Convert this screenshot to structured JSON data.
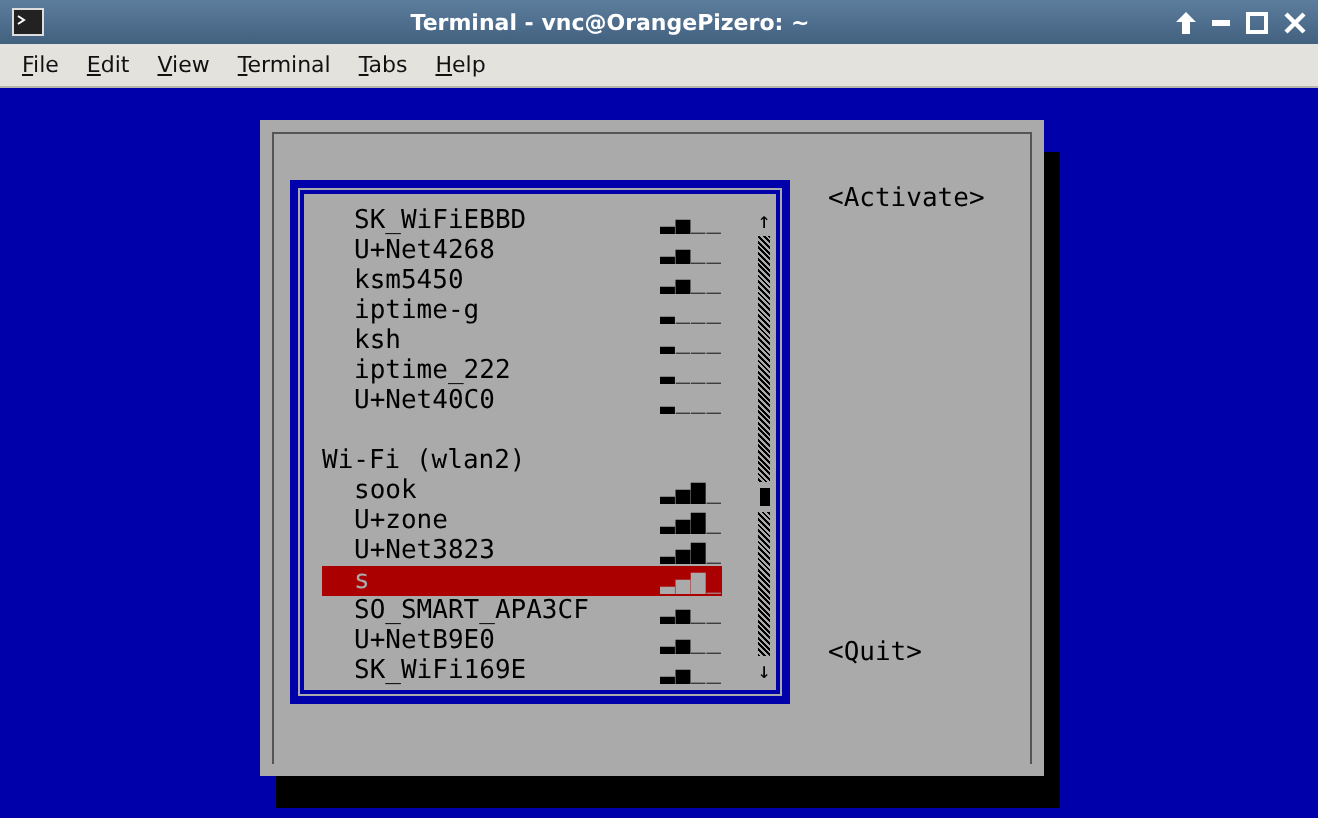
{
  "window": {
    "title": "Terminal - vnc@OrangePizero: ~"
  },
  "menu": [
    "File",
    "Edit",
    "View",
    "Terminal",
    "Tabs",
    "Help"
  ],
  "network_list": {
    "scroll_up": "↑",
    "scroll_down": "↓",
    "sections": [
      {
        "networks": [
          {
            "name": "SK_WiFiEBBD",
            "signal": "▂▄__",
            "selected": false
          },
          {
            "name": "U+Net4268",
            "signal": "▂▄__",
            "selected": false
          },
          {
            "name": "ksm5450",
            "signal": "▂▄__",
            "selected": false
          },
          {
            "name": "iptime-g",
            "signal": "▂___",
            "selected": false
          },
          {
            "name": "ksh",
            "signal": "▂___",
            "selected": false
          },
          {
            "name": "iptime_222",
            "signal": "▂___",
            "selected": false
          },
          {
            "name": "U+Net40C0",
            "signal": "▂___",
            "selected": false
          }
        ]
      },
      {
        "header": "Wi-Fi (wlan2)",
        "networks": [
          {
            "name": "sook",
            "signal": "▂▄▆_",
            "selected": false
          },
          {
            "name": "U+zone",
            "signal": "▂▄▆_",
            "selected": false
          },
          {
            "name": "U+Net3823",
            "signal": "▂▄▆_",
            "selected": false
          },
          {
            "name": "s",
            "signal": "▂▄▆_",
            "selected": true
          },
          {
            "name": "SO_SMART_APA3CF",
            "signal": "▂▄__",
            "selected": false
          },
          {
            "name": "U+NetB9E0",
            "signal": "▂▄__",
            "selected": false
          },
          {
            "name": "SK_WiFi169E",
            "signal": "▂▄__",
            "selected": false
          }
        ]
      }
    ]
  },
  "buttons": [
    "<Activate>",
    "<Quit>"
  ]
}
